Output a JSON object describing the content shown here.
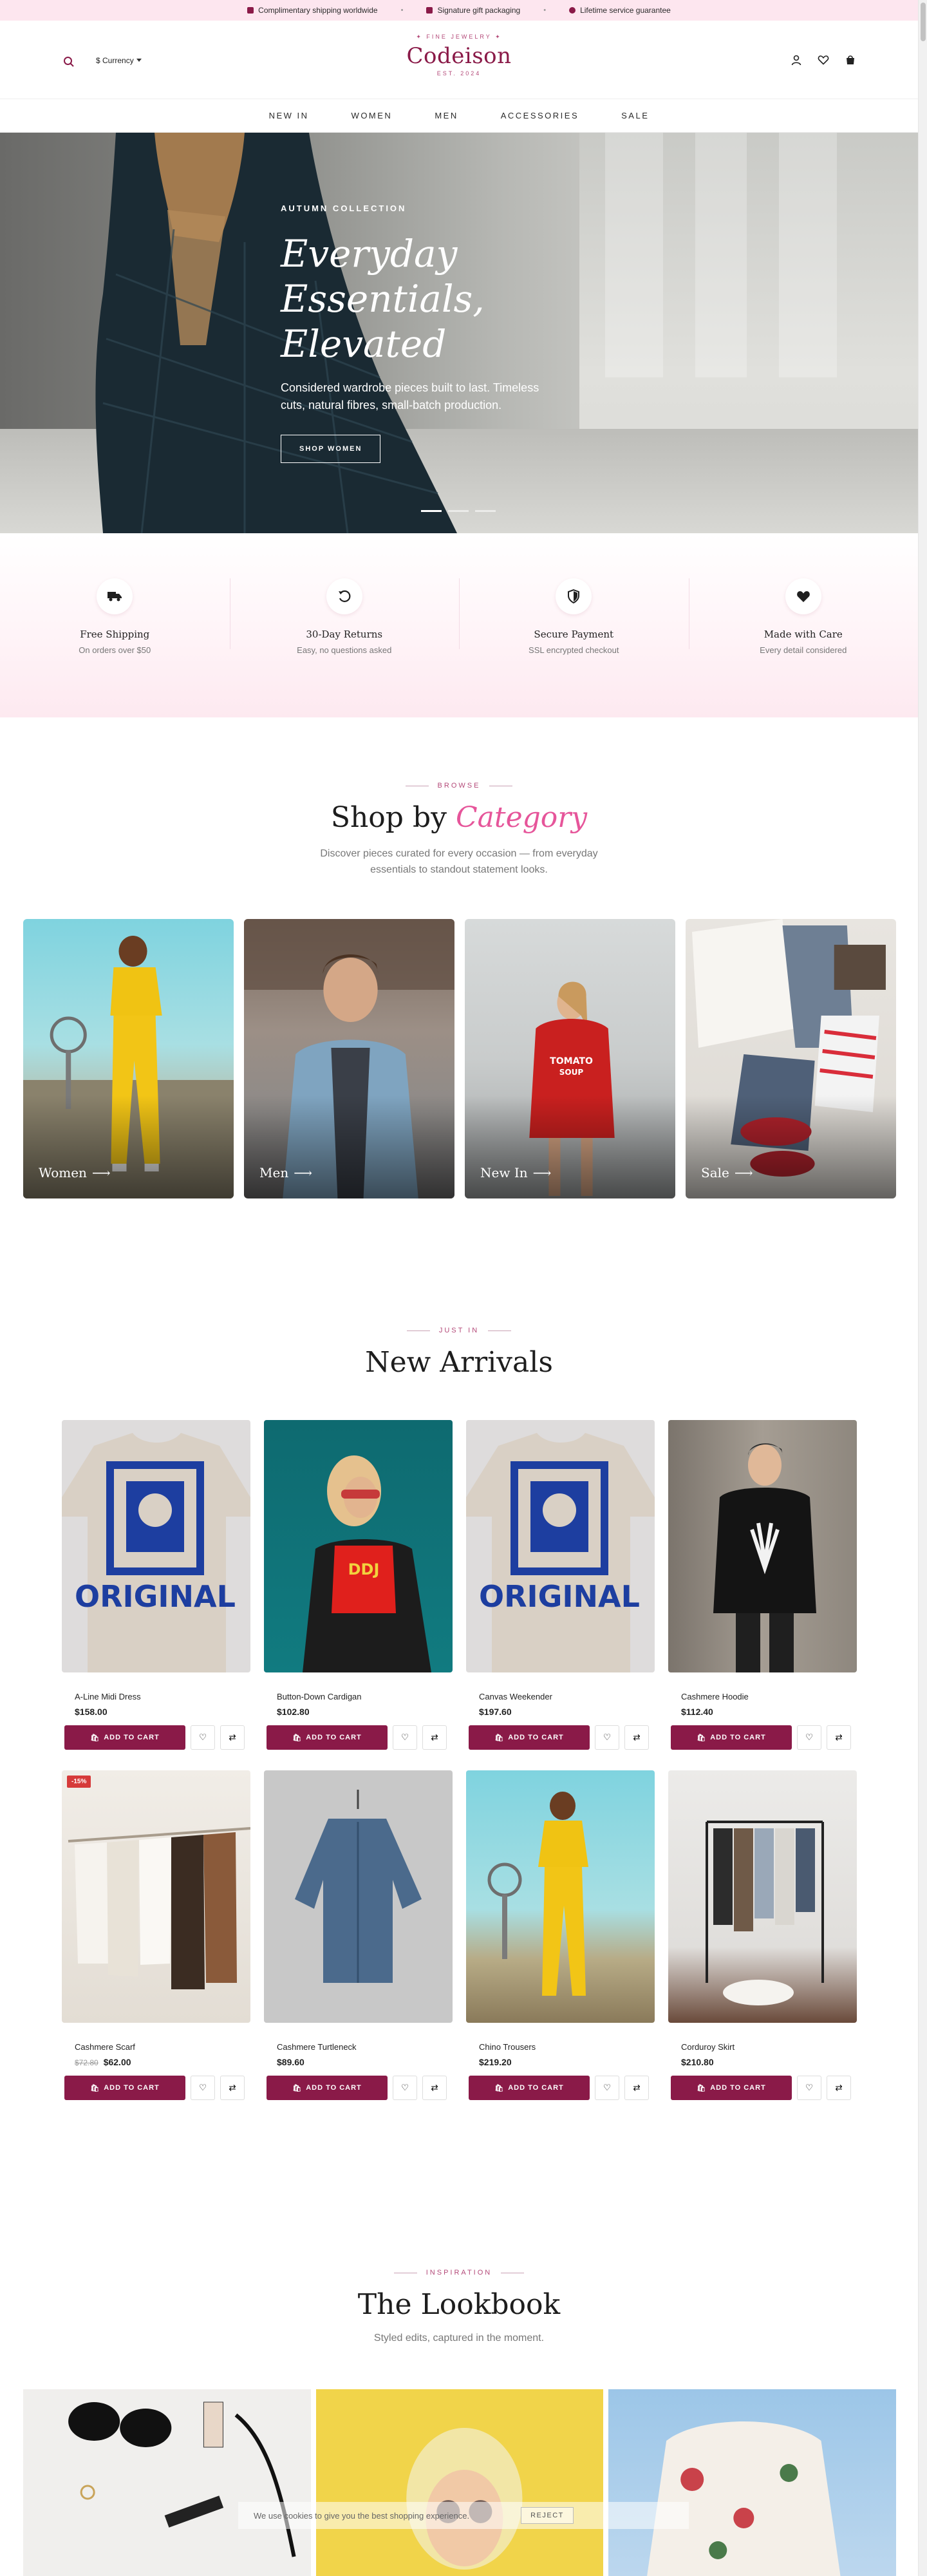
{
  "topbar": {
    "items": [
      "Complimentary shipping worldwide",
      "Signature gift packaging",
      "Lifetime service guarantee"
    ],
    "separator": "•"
  },
  "header": {
    "tagline": "✦ FINE JEWELRY ✦",
    "brand": "Codeison",
    "established": "EST. 2024",
    "currency_label": "$ Currency",
    "icons": [
      "search-icon",
      "user-icon",
      "heart-icon",
      "bag-icon"
    ]
  },
  "nav": {
    "items": [
      "NEW IN",
      "WOMEN",
      "MEN",
      "ACCESSORIES",
      "SALE"
    ]
  },
  "hero": {
    "eyebrow": "AUTUMN COLLECTION",
    "title_line1": "Everyday",
    "title_line2": "Essentials,",
    "title_line3": "Elevated",
    "description": "Considered wardrobe pieces built to last. Timeless cuts, natural fibres, small-batch production.",
    "cta": "SHOP WOMEN",
    "slides": 3,
    "active_slide": 1
  },
  "features": [
    {
      "icon": "truck-icon",
      "title": "Free Shipping",
      "subtitle": "On orders over $50"
    },
    {
      "icon": "return-icon",
      "title": "30-Day Returns",
      "subtitle": "Easy, no questions asked"
    },
    {
      "icon": "shield-icon",
      "title": "Secure Payment",
      "subtitle": "SSL encrypted checkout"
    },
    {
      "icon": "heart-icon",
      "title": "Made with Care",
      "subtitle": "Every detail considered"
    }
  ],
  "categories": {
    "eyebrow": "BROWSE",
    "title_plain": "Shop by",
    "title_accent": "Category",
    "description": "Discover pieces curated for every occasion — from everyday essentials to standout statement looks.",
    "items": [
      {
        "label": "Women"
      },
      {
        "label": "Men"
      },
      {
        "label": "New In"
      },
      {
        "label": "Sale"
      }
    ]
  },
  "arrivals": {
    "eyebrow": "JUST IN",
    "title": "New Arrivals",
    "add_label": "ADD TO CART",
    "products": [
      {
        "name": "A-Line Midi Dress",
        "price": "$158.00",
        "old_price": "",
        "badge": ""
      },
      {
        "name": "Button-Down Cardigan",
        "price": "$102.80",
        "old_price": "",
        "badge": ""
      },
      {
        "name": "Canvas Weekender",
        "price": "$197.60",
        "old_price": "",
        "badge": ""
      },
      {
        "name": "Cashmere Hoodie",
        "price": "$112.40",
        "old_price": "",
        "badge": ""
      },
      {
        "name": "Cashmere Scarf",
        "price": "$62.00",
        "old_price": "$72.80",
        "badge": "-15%"
      },
      {
        "name": "Cashmere Turtleneck",
        "price": "$89.60",
        "old_price": "",
        "badge": ""
      },
      {
        "name": "Chino Trousers",
        "price": "$219.20",
        "old_price": "",
        "badge": ""
      },
      {
        "name": "Corduroy Skirt",
        "price": "$210.80",
        "old_price": "",
        "badge": ""
      }
    ]
  },
  "lookbook": {
    "eyebrow": "INSPIRATION",
    "title": "The Lookbook",
    "subtitle": "Styled edits, captured in the moment."
  },
  "cookie": {
    "text": "We use cookies to give you the best shopping experience.",
    "reject": "REJECT"
  },
  "colors": {
    "brand": "#8a1a48",
    "accent_pink": "#e6559a",
    "topbar_bg": "#fde6ef",
    "sale_badge": "#d63a3a"
  }
}
